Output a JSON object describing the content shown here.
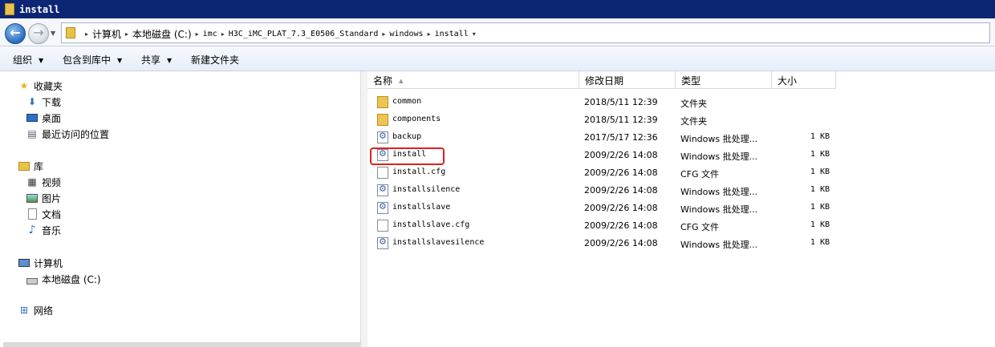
{
  "window": {
    "title": "install"
  },
  "address": {
    "crumbs": [
      "计算机",
      "本地磁盘 (C:)",
      "imc",
      "H3C_iMC_PLAT_7.3_E0506_Standard",
      "windows",
      "install"
    ]
  },
  "toolbar": {
    "organize": "组织",
    "include_in_library": "包含到库中",
    "share": "共享",
    "new_folder": "新建文件夹"
  },
  "nav": {
    "favorites": "收藏夹",
    "downloads": "下载",
    "desktop": "桌面",
    "recent": "最近访问的位置",
    "libraries": "库",
    "videos": "视频",
    "pictures": "图片",
    "documents": "文档",
    "music": "音乐",
    "computer": "计算机",
    "local_disk": "本地磁盘 (C:)",
    "network": "网络"
  },
  "columns": {
    "name": "名称",
    "date": "修改日期",
    "type": "类型",
    "size": "大小"
  },
  "files": [
    {
      "name": "common",
      "date": "2018/5/11 12:39",
      "type": "文件夹",
      "size": "",
      "icon": "folder-icon"
    },
    {
      "name": "components",
      "date": "2018/5/11 12:39",
      "type": "文件夹",
      "size": "",
      "icon": "folder-icon"
    },
    {
      "name": "backup",
      "date": "2017/5/17 12:36",
      "type": "Windows 批处理...",
      "size": "1 KB",
      "icon": "batch-file-icon"
    },
    {
      "name": "install",
      "date": "2009/2/26 14:08",
      "type": "Windows 批处理...",
      "size": "1 KB",
      "icon": "batch-file-icon"
    },
    {
      "name": "install.cfg",
      "date": "2009/2/26 14:08",
      "type": "CFG 文件",
      "size": "1 KB",
      "icon": "text-file-icon"
    },
    {
      "name": "installsilence",
      "date": "2009/2/26 14:08",
      "type": "Windows 批处理...",
      "size": "1 KB",
      "icon": "batch-file-icon"
    },
    {
      "name": "installslave",
      "date": "2009/2/26 14:08",
      "type": "Windows 批处理...",
      "size": "1 KB",
      "icon": "batch-file-icon"
    },
    {
      "name": "installslave.cfg",
      "date": "2009/2/26 14:08",
      "type": "CFG 文件",
      "size": "1 KB",
      "icon": "text-file-icon"
    },
    {
      "name": "installslavesilence",
      "date": "2009/2/26 14:08",
      "type": "Windows 批处理...",
      "size": "1 KB",
      "icon": "batch-file-icon"
    }
  ],
  "colors": {
    "title_bar": "#0c2673",
    "highlight": "#e02020",
    "selected_nav": "#dadada"
  }
}
